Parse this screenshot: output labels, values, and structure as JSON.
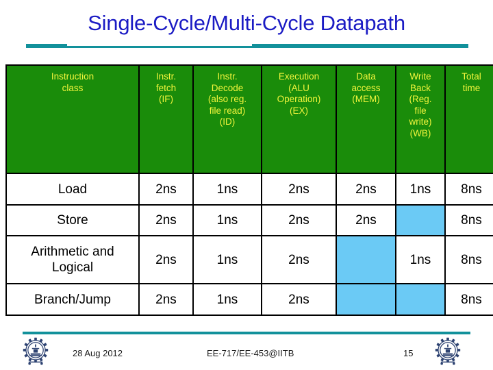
{
  "slide": {
    "title": "Single-Cycle/Multi-Cycle Datapath",
    "title_color": "#1b1bc4",
    "rule_color": "#12919b"
  },
  "table": {
    "header_bg": "#1a8c0a",
    "header_fg": "#f2f53c",
    "empty_cell_color": "#6bcaf5",
    "columns": [
      {
        "id": "instruction-class",
        "label": "Instruction\nclass",
        "lines": [
          "Instruction",
          "class"
        ]
      },
      {
        "id": "instr-fetch",
        "label": "Instr. fetch (IF)",
        "lines": [
          "Instr.",
          "fetch",
          "(IF)"
        ]
      },
      {
        "id": "instr-decode",
        "label": "Instr. Decode (also reg. file read) (ID)",
        "lines": [
          "Instr.",
          "Decode",
          "(also reg.",
          "file read)",
          "(ID)"
        ]
      },
      {
        "id": "execution",
        "label": "Execution (ALU Operation) (EX)",
        "lines": [
          "Execution",
          "(ALU",
          "Operation)",
          "(EX)"
        ]
      },
      {
        "id": "data-access",
        "label": "Data access (MEM)",
        "lines": [
          "Data",
          "access",
          "(MEM)"
        ]
      },
      {
        "id": "write-back",
        "label": "Write Back (Reg. file write) (WB)",
        "lines": [
          "Write",
          "Back",
          "(Reg.",
          "file",
          "write)",
          "(WB)"
        ]
      },
      {
        "id": "total-time",
        "label": "Total time",
        "lines": [
          "Total",
          "time"
        ]
      }
    ],
    "rows": [
      {
        "id": "load",
        "class_lines": [
          "Load"
        ],
        "cells": [
          "2ns",
          "1ns",
          "2ns",
          "2ns",
          "1ns",
          "8ns"
        ]
      },
      {
        "id": "store",
        "class_lines": [
          "Store"
        ],
        "cells": [
          "2ns",
          "1ns",
          "2ns",
          "2ns",
          "",
          "8ns"
        ]
      },
      {
        "id": "arithmetic-logical",
        "class_lines": [
          "Arithmetic and",
          "Logical"
        ],
        "cells": [
          "2ns",
          "1ns",
          "2ns",
          "",
          "1ns",
          "8ns"
        ]
      },
      {
        "id": "branch-jump",
        "class_lines": [
          "Branch/Jump"
        ],
        "cells": [
          "2ns",
          "1ns",
          "2ns",
          "",
          "",
          "8ns"
        ]
      }
    ]
  },
  "footer": {
    "date": "28 Aug 2012",
    "course": "EE-717/EE-453@IITB",
    "page_number": "15",
    "logo_name": "iitb-gear-logo"
  }
}
